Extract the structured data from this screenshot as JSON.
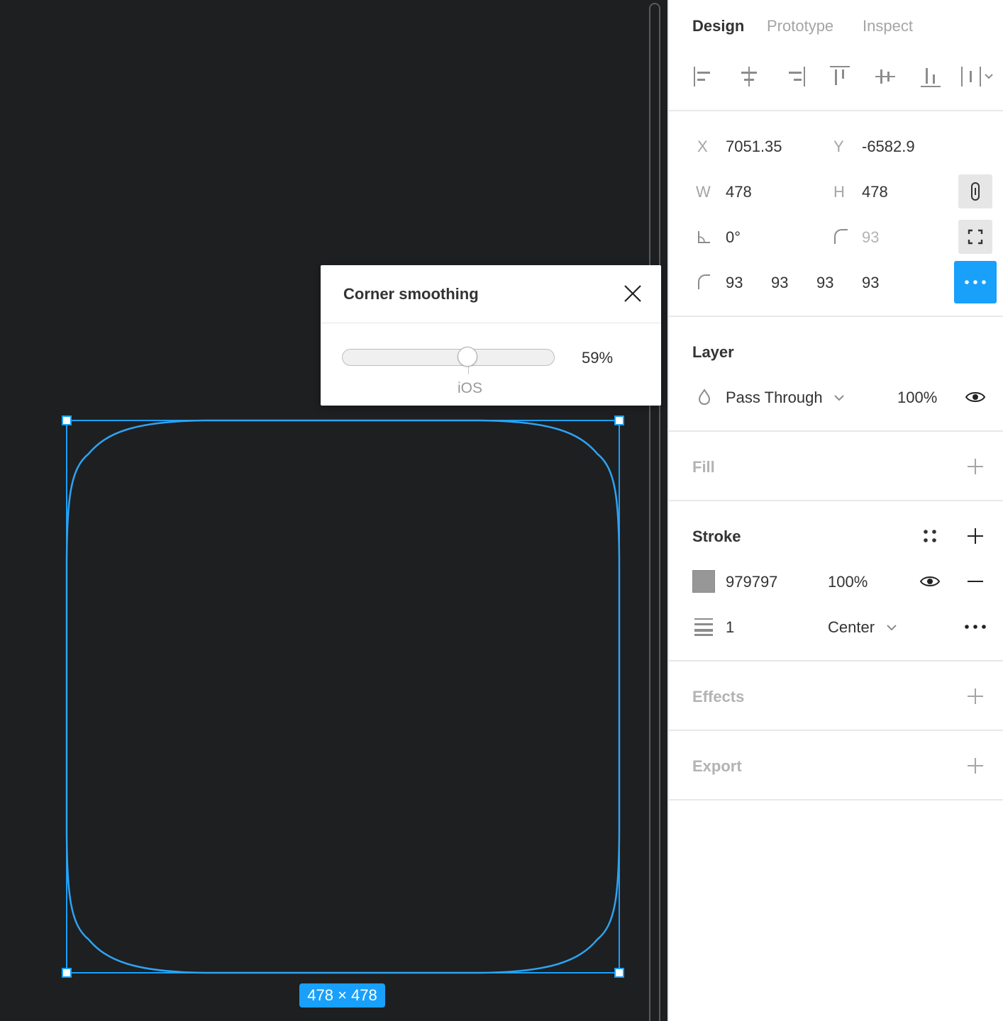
{
  "canvas": {
    "size_badge": "478 × 478",
    "accent_color": "#18a0fb"
  },
  "popup": {
    "title": "Corner smoothing",
    "slider_value_text": "59%",
    "slider_fraction": 0.59,
    "preset_label": "iOS"
  },
  "panel": {
    "tabs": [
      {
        "label": "Design",
        "active": true
      },
      {
        "label": "Prototype",
        "active": false
      },
      {
        "label": "Inspect",
        "active": false
      }
    ],
    "transform": {
      "x_label": "X",
      "x_value": "7051.35",
      "y_label": "Y",
      "y_value": "-6582.9",
      "w_label": "W",
      "w_value": "478",
      "h_label": "H",
      "h_value": "478",
      "rotation_value": "0°",
      "radius_value": "93",
      "corners": [
        "93",
        "93",
        "93",
        "93"
      ]
    },
    "layer": {
      "title": "Layer",
      "blend_mode": "Pass Through",
      "opacity": "100%"
    },
    "fill": {
      "title": "Fill"
    },
    "stroke": {
      "title": "Stroke",
      "color_hex": "979797",
      "color": "#979797",
      "opacity": "100%",
      "weight": "1",
      "position": "Center"
    },
    "effects": {
      "title": "Effects"
    },
    "export": {
      "title": "Export"
    }
  }
}
